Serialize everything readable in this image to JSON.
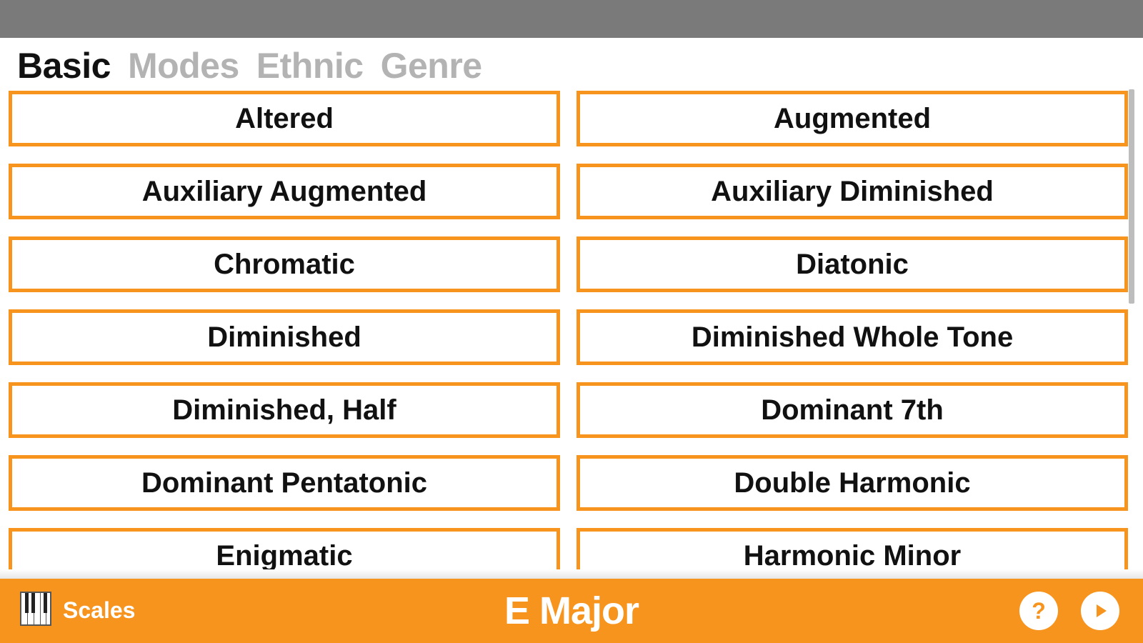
{
  "tabs": [
    {
      "label": "Basic",
      "active": true
    },
    {
      "label": "Modes",
      "active": false
    },
    {
      "label": "Ethnic",
      "active": false
    },
    {
      "label": "Genre",
      "active": false
    }
  ],
  "scales": [
    "Altered",
    "Augmented",
    "Auxiliary Augmented",
    "Auxiliary Diminished",
    "Chromatic",
    "Diatonic",
    "Diminished",
    "Diminished Whole Tone",
    "Diminished, Half",
    "Dominant 7th",
    "Dominant Pentatonic",
    "Double Harmonic",
    "Enigmatic",
    "Harmonic Minor"
  ],
  "bottom_bar": {
    "app_label": "Scales",
    "current_scale": "E Major",
    "help_label": "?"
  },
  "colors": {
    "accent": "#f7941d",
    "status_bar": "#7a7a7a",
    "inactive_tab": "#b3b3b3"
  },
  "icons": {
    "app": "piano-icon",
    "help": "help-icon",
    "play": "play-icon"
  }
}
